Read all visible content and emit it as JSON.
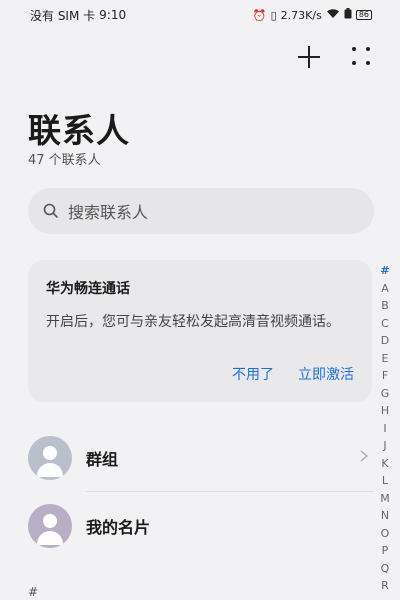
{
  "status_bar": {
    "carrier": "没有 SIM 卡",
    "time": "9:10",
    "net_speed": "2.73K/s",
    "battery": "86"
  },
  "header": {
    "title": "联系人",
    "count": "47 个联系人"
  },
  "search": {
    "placeholder": "搜索联系人"
  },
  "promo": {
    "title": "华为畅连通话",
    "description": "开启后，您可与亲友轻松发起高清音视频通话。",
    "dismiss_label": "不用了",
    "activate_label": "立即激活"
  },
  "rows": [
    {
      "label": "群组"
    },
    {
      "label": "我的名片"
    }
  ],
  "section_header": "#",
  "alpha_index": [
    "#",
    "A",
    "B",
    "C",
    "D",
    "E",
    "F",
    "G",
    "H",
    "I",
    "J",
    "K",
    "L",
    "M",
    "N",
    "O",
    "P",
    "Q",
    "R"
  ],
  "colors": {
    "accent": "#1f6fd6",
    "background": "#f2f2f4"
  }
}
